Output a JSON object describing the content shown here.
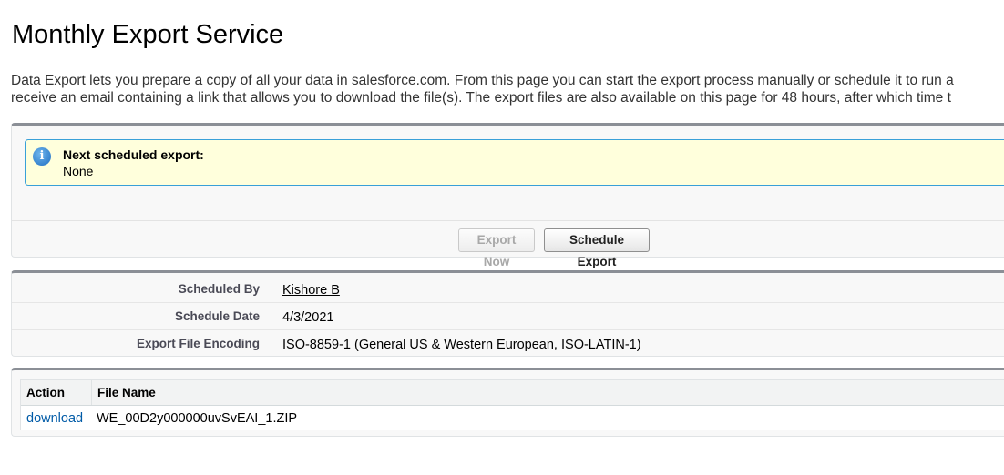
{
  "page": {
    "title": "Monthly Export Service",
    "description_line1": "Data Export lets you prepare a copy of all your data in salesforce.com. From this page you can start the export process manually or schedule it to run a",
    "description_line2": "receive an email containing a link that allows you to download the file(s). The export files are also available on this page for 48 hours, after which time t"
  },
  "message": {
    "title": "Next scheduled export:",
    "value": "None",
    "icon": "info-icon"
  },
  "buttons": {
    "export_now": "Export Now",
    "schedule_export": "Schedule Export"
  },
  "details": [
    {
      "label": "Scheduled By",
      "value": "Kishore B"
    },
    {
      "label": "Schedule Date",
      "value": "4/3/2021"
    },
    {
      "label": "Export File Encoding",
      "value": "ISO-8859-1 (General US & Western European, ISO-LATIN-1)"
    }
  ],
  "table": {
    "columns": [
      "Action",
      "File Name"
    ],
    "rows": [
      {
        "action": "download",
        "file_name": "WE_00D2y000000uvSvEAI_1.ZIP"
      }
    ]
  },
  "colors": {
    "link": "#015ba7",
    "message_bg": "#ffffdc",
    "message_border": "#39a0d8"
  }
}
